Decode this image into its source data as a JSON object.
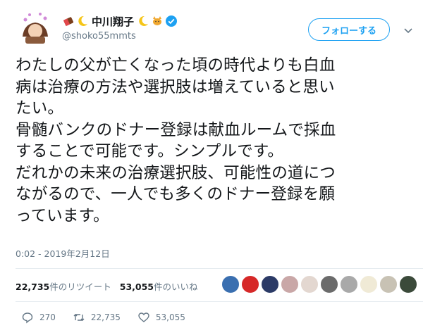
{
  "user": {
    "display_name": "中川翔子",
    "handle": "@shoko55mmts",
    "verified": true
  },
  "follow_label": "フォローする",
  "tweet_lines": [
    "わたしの父が亡くなった頃の時代よりも白血",
    "病は治療の方法や選択肢は増えていると思い",
    "たい。",
    "骨髄バンクのドナー登録は献血ルームで採血",
    "することで可能です。シンプルです。",
    "だれかの未来の治療選択肢、可能性の道につ",
    "ながるので、一人でも多くのドナー登録を願",
    "っています。"
  ],
  "timestamp": "0:02 - 2019年2月12日",
  "stats": {
    "retweet_count": "22,735",
    "retweet_label": "件のリツイート",
    "like_count": "53,055",
    "like_label": "件のいいね"
  },
  "actions": {
    "reply_count": "270",
    "retweet_count": "22,735",
    "like_count": "53,055"
  },
  "colors": {
    "accent": "#1da1f2",
    "muted": "#657786",
    "text": "#14171a",
    "divider": "#e6ecf0"
  },
  "liker_avatar_colors": [
    "#3a6fb0",
    "#d62828",
    "#2b3a66",
    "#c9a7a7",
    "#e3d7d0",
    "#6b6b6b",
    "#a9a9a9",
    "#f0ead6",
    "#c8c2b4",
    "#3b4a3a"
  ]
}
